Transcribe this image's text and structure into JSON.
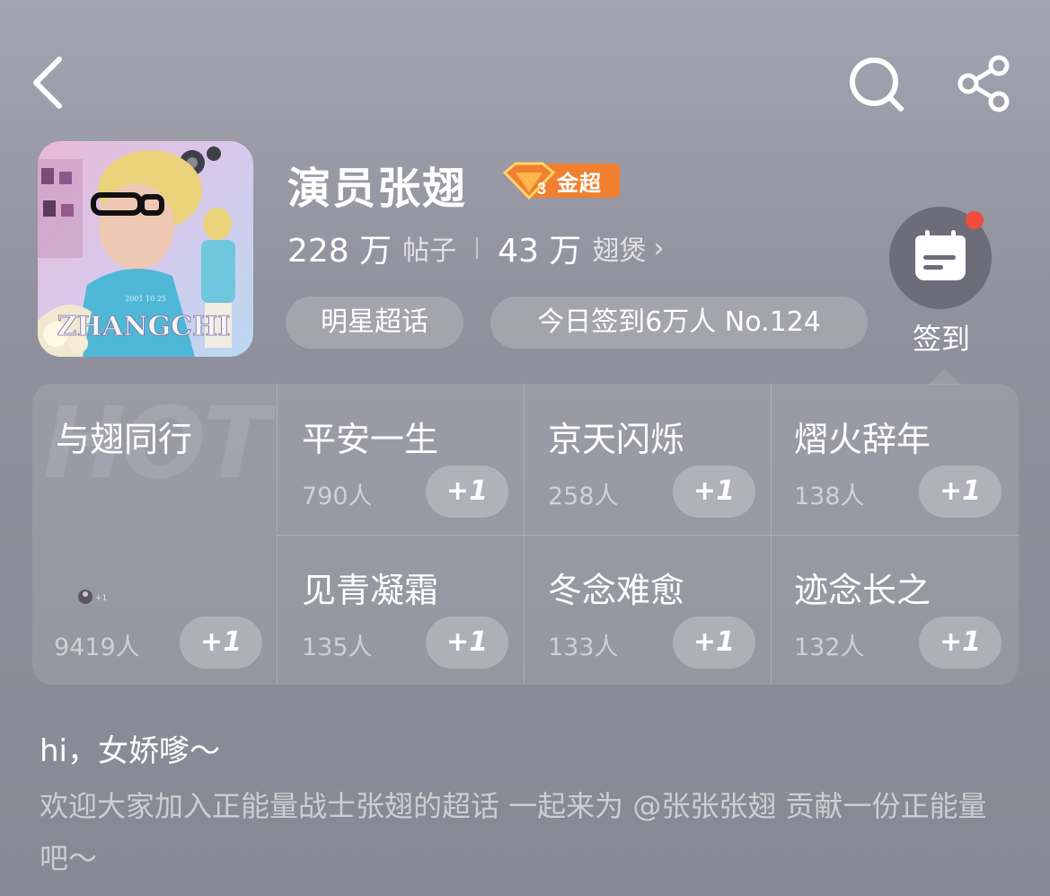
{
  "topbar": {
    "back_icon": "back-arrow-icon",
    "search_icon": "search-icon",
    "share_icon": "share-icon"
  },
  "topic": {
    "title": "演员张翅",
    "badge_level": "3",
    "badge_label": "金超",
    "badge_color": "#f0802f",
    "cover_text": "ZHANGCHI",
    "posts_count": "228 万",
    "posts_label": "帖子",
    "fans_count": "43 万",
    "fans_label": "翅煲",
    "category": "明星超话",
    "checkin_info": "今日签到6万人 No.124"
  },
  "checkin": {
    "label": "签到",
    "icon": "calendar-icon",
    "notification_color": "#f04b3d"
  },
  "groups": {
    "watermark": "HOT",
    "featured": {
      "name": "与翅同行",
      "count": "9419人",
      "button": "+1"
    },
    "items": [
      {
        "name": "平安一生",
        "count": "790人",
        "button": "+1"
      },
      {
        "name": "京天闪烁",
        "count": "258人",
        "button": "+1"
      },
      {
        "name": "熠火辞年",
        "count": "138人",
        "button": "+1"
      },
      {
        "name": "见青凝霜",
        "count": "135人",
        "button": "+1"
      },
      {
        "name": "冬念难愈",
        "count": "133人",
        "button": "+1"
      },
      {
        "name": "迹念长之",
        "count": "132人",
        "button": "+1"
      }
    ]
  },
  "intro": {
    "greeting": "hi，女娇嗲～",
    "description": "欢迎大家加入正能量战士张翅的超话 一起来为 @张张张翅 贡献一份正能量吧～"
  }
}
